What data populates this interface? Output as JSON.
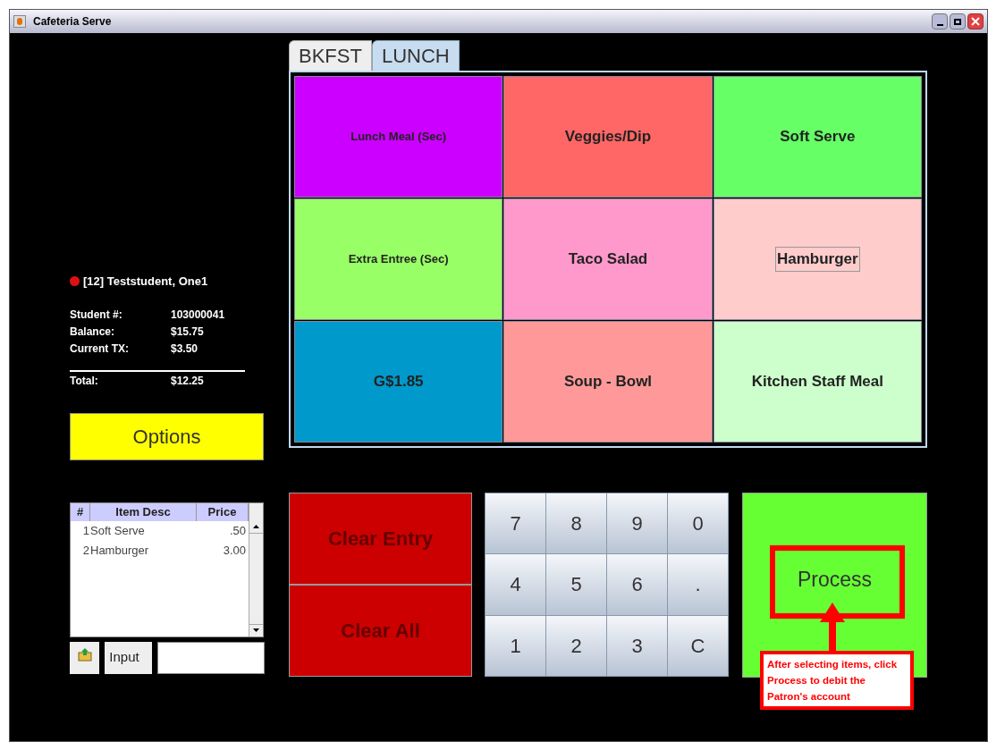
{
  "window": {
    "title": "Cafeteria Serve"
  },
  "patron": {
    "name": "[12] Teststudent, One1",
    "fields": [
      {
        "label": "Student #:",
        "value": "103000041"
      },
      {
        "label": "Balance:",
        "value": "$15.75"
      },
      {
        "label": "Current TX:",
        "value": "$3.50"
      }
    ],
    "total": {
      "label": "Total:",
      "value": "$12.25"
    }
  },
  "options_button": "Options",
  "items_table": {
    "columns": [
      "#",
      "Item Desc",
      "Price"
    ],
    "rows": [
      {
        "num": "1",
        "desc": "Soft Serve",
        "price": ".50"
      },
      {
        "num": "2",
        "desc": "Hamburger",
        "price": "3.00"
      }
    ]
  },
  "input": {
    "label": "Input"
  },
  "tabs": [
    {
      "label": "BKFST",
      "selected": false
    },
    {
      "label": "LUNCH",
      "selected": true
    }
  ],
  "menu_buttons": [
    {
      "label": "Lunch Meal (Sec)",
      "color": "#cc00ff",
      "kind": "small",
      "focused": false
    },
    {
      "label": "Veggies/Dip",
      "color": "#ff6666",
      "kind": "large",
      "focused": false
    },
    {
      "label": "Soft Serve",
      "color": "#66ff66",
      "kind": "large",
      "focused": false
    },
    {
      "label": "Extra Entree (Sec)",
      "color": "#99ff66",
      "kind": "small",
      "focused": false
    },
    {
      "label": "Taco Salad",
      "color": "#ff99cc",
      "kind": "large",
      "focused": false
    },
    {
      "label": "Hamburger",
      "color": "#ffcccc",
      "kind": "large",
      "focused": true
    },
    {
      "label": "G$1.85",
      "color": "#0099cc",
      "kind": "large",
      "focused": false
    },
    {
      "label": "Soup - Bowl",
      "color": "#ff9999",
      "kind": "large",
      "focused": false
    },
    {
      "label": "Kitchen Staff Meal",
      "color": "#ccffcc",
      "kind": "large",
      "focused": false
    }
  ],
  "clear_buttons": [
    "Clear Entry",
    "Clear All"
  ],
  "keypad": [
    "7",
    "8",
    "9",
    "0",
    "4",
    "5",
    "6",
    ".",
    "1",
    "2",
    "3",
    "C"
  ],
  "process_button": "Process",
  "callout": "After selecting items, click Process to debit the Patron's account"
}
